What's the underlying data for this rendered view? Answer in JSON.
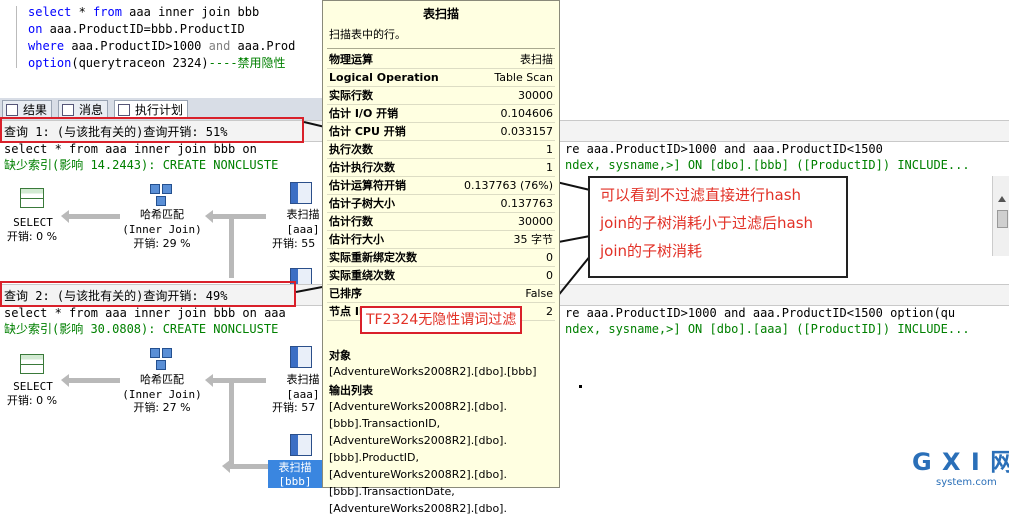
{
  "editor": {
    "lines": [
      {
        "t1": "select",
        "t2": " * ",
        "t3": "from",
        "t4": " aaa inner join bbb"
      },
      {
        "t1": "on",
        "t2": " aaa.ProductID=bbb.ProductID"
      },
      {
        "t1": "where",
        "t2": " aaa.ProductID>1000 ",
        "t3": "and",
        "t4": " aaa.Prod"
      },
      {
        "t1": "option",
        "t2": "(querytraceon 2324)",
        "t3": "----禁用隐性"
      }
    ]
  },
  "tabs": [
    {
      "label": "结果"
    },
    {
      "label": "消息"
    },
    {
      "label": "执行计划"
    }
  ],
  "query1": {
    "title": "查询 1: (与该批有关的)查询开销: 51%",
    "sql_left": "select * from aaa inner join bbb on",
    "sql_right": "re aaa.ProductID>1000 and aaa.ProductID<1500",
    "missing_left": "缺少索引(影响 14.2443): CREATE NONCLUSTE",
    "missing_right": "ndex, sysname,>] ON [dbo].[bbb] ([ProductID]) INCLUDE..."
  },
  "query2": {
    "title": "查询 2: (与该批有关的)查询开销: 49%",
    "sql_left": "select * from aaa inner join bbb on aaa",
    "sql_right": "re aaa.ProductID>1000 and aaa.ProductID<1500 option(qu",
    "missing_left": "缺少索引(影响 30.0808): CREATE NONCLUSTE",
    "missing_right": "ndex, sysname,>] ON [dbo].[aaa] ([ProductID]) INCLUDE..."
  },
  "plan1": {
    "select_label": "SELECT",
    "select_cost": "开销: 0 %",
    "hash_label": "哈希匹配",
    "hash_sub": "(Inner Join)",
    "hash_cost": "开销: 29 %",
    "scan_label": "表扫描",
    "scan_sub": "[aaa]",
    "scan_cost": "开销: 55"
  },
  "plan2": {
    "select_label": "SELECT",
    "select_cost": "开销: 0 %",
    "hash_label": "哈希匹配",
    "hash_sub": "(Inner Join)",
    "hash_cost": "开销: 27 %",
    "scan_label": "表扫描",
    "scan_sub": "[aaa]",
    "scan_cost": "开销: 57",
    "scan2_label": "表扫描",
    "scan2_sub": "[bbb]"
  },
  "tooltip": {
    "title": "表扫描",
    "desc": "扫描表中的行。",
    "rows": [
      {
        "k": "物理运算",
        "v": "表扫描"
      },
      {
        "k": "Logical Operation",
        "v": "Table Scan"
      },
      {
        "k": "实际行数",
        "v": "30000"
      },
      {
        "k": "估计 I/O 开销",
        "v": "0.104606"
      },
      {
        "k": "估计 CPU 开销",
        "v": "0.033157"
      },
      {
        "k": "执行次数",
        "v": "1"
      },
      {
        "k": "估计执行次数",
        "v": "1"
      },
      {
        "k": "估计运算符开销",
        "v": "0.137763 (76%)"
      },
      {
        "k": "估计子树大小",
        "v": "0.137763"
      },
      {
        "k": "估计行数",
        "v": "30000"
      },
      {
        "k": "估计行大小",
        "v": "35 字节"
      },
      {
        "k": "实际重新绑定次数",
        "v": "0"
      },
      {
        "k": "实际重绕次数",
        "v": "0"
      },
      {
        "k": "已排序",
        "v": "False"
      },
      {
        "k": "节点 ID",
        "v": "2"
      }
    ],
    "object_heading": "对象",
    "object_value": "[AdventureWorks2008R2].[dbo].[bbb]",
    "output_heading": "输出列表",
    "output_lines": [
      "[AdventureWorks2008R2].[dbo].",
      "[bbb].TransactionID,",
      "[AdventureWorks2008R2].[dbo].",
      "[bbb].ProductID,",
      "[AdventureWorks2008R2].[dbo].",
      "[bbb].TransactionDate,",
      "[AdventureWorks2008R2].[dbo]."
    ]
  },
  "annotation": {
    "lines": [
      "可以看到不过滤直接进行hash",
      "join的子树消耗小于过滤后hash",
      "join的子树消耗"
    ]
  },
  "tf_label": "TF2324无隐性谓词过滤",
  "watermark": {
    "brand": "G X I 网",
    "site": "system.com"
  },
  "colors": {
    "keyword": "#0000ff",
    "comment": "#008000",
    "annotation": "#e23127",
    "tooltip_bg": "#ffffe1"
  }
}
